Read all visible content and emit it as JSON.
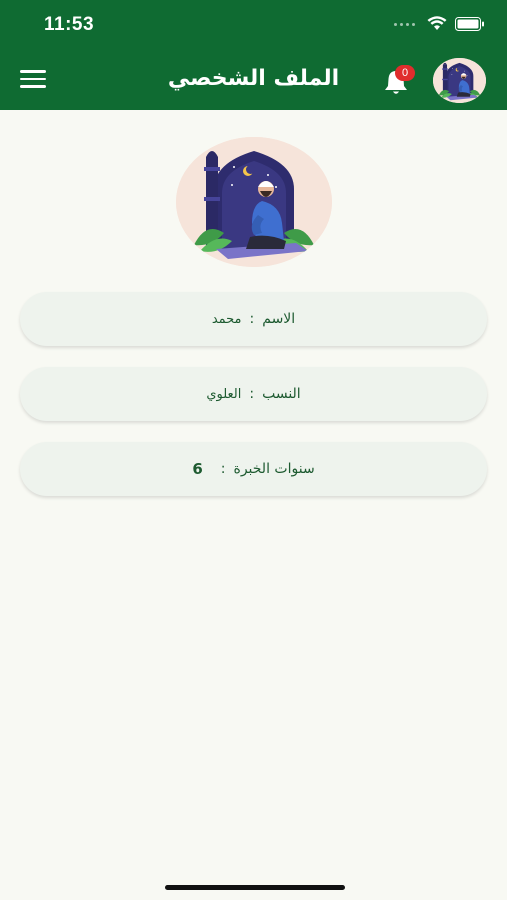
{
  "status_bar": {
    "time": "11:53"
  },
  "header": {
    "title": "الملف الشخصي",
    "notification_count": "0"
  },
  "profile": {
    "fields": [
      {
        "label": "الاسم",
        "separator": ":",
        "value": "محمد"
      },
      {
        "label": "النسب",
        "separator": ":",
        "value": "العلوي"
      },
      {
        "label": "سنوات الخبرة",
        "separator": ":",
        "value": "6"
      }
    ]
  },
  "colors": {
    "header_bg": "#0f6b32",
    "badge": "#e02d2d",
    "field_text": "#1d5a30",
    "page_bg": "#f8f9f3"
  },
  "icons": [
    "menu-icon",
    "bell-icon",
    "wifi-icon",
    "battery-icon",
    "signal-dots-icon"
  ]
}
